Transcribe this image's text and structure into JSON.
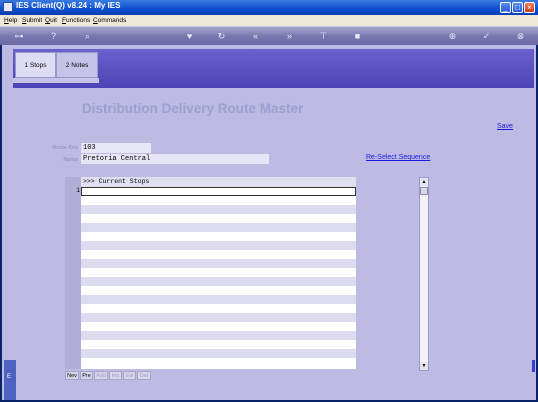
{
  "window": {
    "title": "IES Client(Q) v8.24 : My IES",
    "controls": [
      "minimize",
      "maximize",
      "close"
    ]
  },
  "menu": [
    {
      "label": "Help",
      "accel": "H"
    },
    {
      "label": "Submit",
      "accel": "S"
    },
    {
      "label": "Quit",
      "accel": "Q"
    },
    {
      "label": "Functions",
      "accel": "F"
    },
    {
      "label": "Commands",
      "accel": "C"
    }
  ],
  "toolbar": {
    "icons": [
      "key-icon",
      "help-icon",
      "search-icon",
      "heart-icon",
      "refresh-icon",
      "rewind-icon",
      "fast-forward-icon",
      "pin-icon",
      "stop-icon",
      "add-icon",
      "ok-icon",
      "close-icon"
    ]
  },
  "tabs": [
    {
      "label": "1 Stops",
      "active": true
    },
    {
      "label": "2 Notes",
      "active": false
    }
  ],
  "page": {
    "heading": "Distribution Delivery Route Master",
    "save_link": "Save",
    "reselect_link": "Re-Select Sequence"
  },
  "form": {
    "route_key_label": "Route Key",
    "route_key_value": "103",
    "name_label": "Name",
    "name_value": "Pretoria Central"
  },
  "grid": {
    "header": ">>> Current Stops",
    "current_row_number": "1"
  },
  "buttons": [
    {
      "label": "Nev",
      "enabled": true
    },
    {
      "label": "Pre",
      "enabled": true
    },
    {
      "label": "Add",
      "enabled": false
    },
    {
      "label": "Ins",
      "enabled": false
    },
    {
      "label": "Ed",
      "enabled": false
    },
    {
      "label": "Del",
      "enabled": false
    }
  ],
  "left_edge_text": "E"
}
